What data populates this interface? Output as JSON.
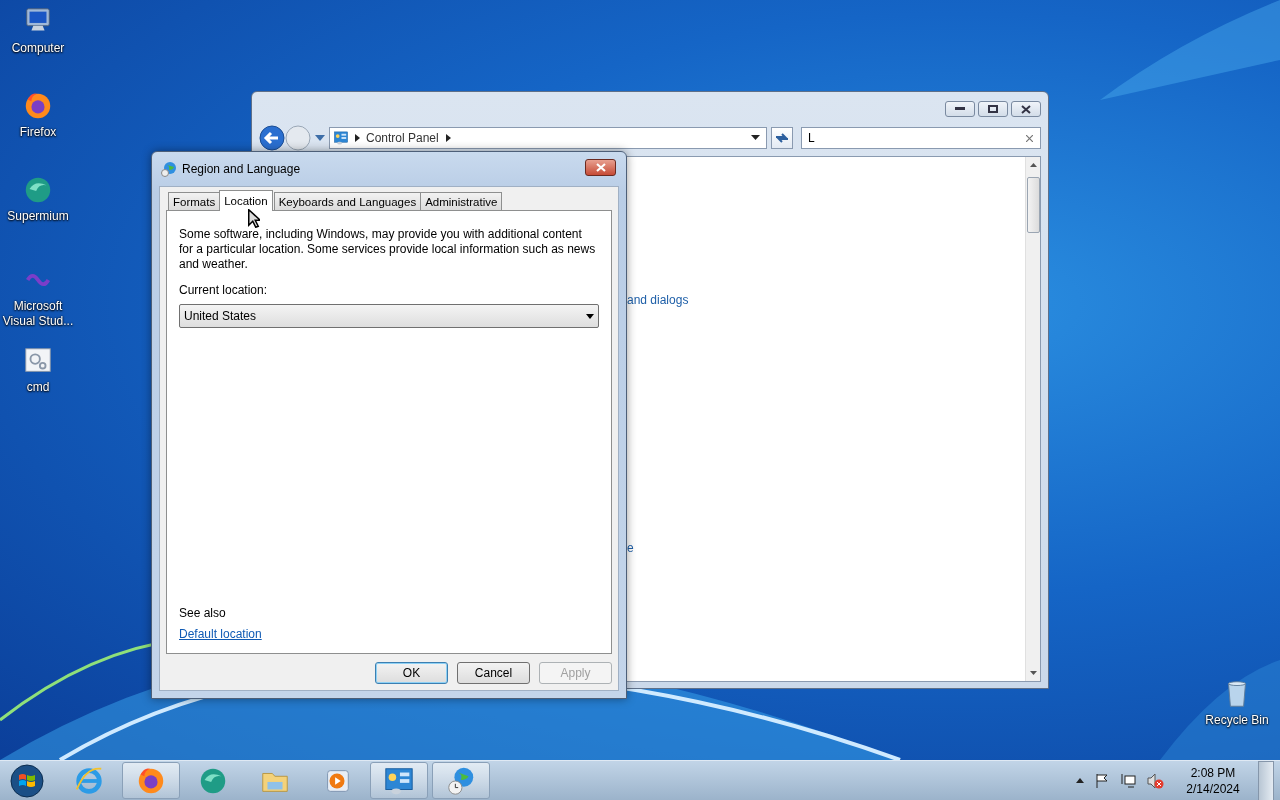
{
  "desktop_icons": [
    {
      "label": "Computer",
      "kind": "computer"
    },
    {
      "label": "Firefox",
      "kind": "firefox"
    },
    {
      "label": "Supermium",
      "kind": "supermium"
    },
    {
      "label": "Microsoft Visual Stud...",
      "kind": "vs"
    },
    {
      "label": "cmd",
      "kind": "cmd"
    },
    {
      "label": "Recycle Bin",
      "kind": "recycle"
    }
  ],
  "control_panel": {
    "breadcrumb": "Control Panel",
    "search": {
      "value": "L"
    },
    "links": [
      "and dialogs",
      "e"
    ]
  },
  "dialog": {
    "title": "Region and Language",
    "tabs": [
      {
        "label": "Formats",
        "selected": false
      },
      {
        "label": "Location",
        "selected": true
      },
      {
        "label": "Keyboards and Languages",
        "selected": false
      },
      {
        "label": "Administrative",
        "selected": false
      }
    ],
    "description": "Some software, including Windows, may provide you with additional content for a particular location. Some services provide local information such as news and weather.",
    "current_location_label": "Current location:",
    "current_location": "United States",
    "see_also": "See also",
    "default_location_link": "Default location",
    "buttons": [
      {
        "label": "OK",
        "disabled": false,
        "default": true
      },
      {
        "label": "Cancel",
        "disabled": false,
        "default": false
      },
      {
        "label": "Apply",
        "disabled": true,
        "default": false
      }
    ]
  },
  "taskbar": {
    "items": [
      {
        "kind": "ie",
        "running": false
      },
      {
        "kind": "firefox",
        "running": true
      },
      {
        "kind": "supermium",
        "running": false
      },
      {
        "kind": "explorer",
        "running": false
      },
      {
        "kind": "media",
        "running": false
      },
      {
        "kind": "controlpanel",
        "running": true
      },
      {
        "kind": "region",
        "running": true
      }
    ],
    "clock": {
      "time": "2:08 PM",
      "date": "2/14/2024"
    }
  }
}
